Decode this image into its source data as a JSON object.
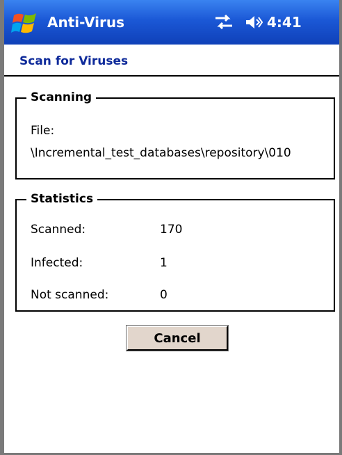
{
  "titlebar": {
    "app_title": "Anti-Virus",
    "time": "4:41",
    "icons": [
      "windows-flag-icon",
      "connectivity-icon",
      "volume-icon"
    ]
  },
  "page": {
    "heading": "Scan for Viruses"
  },
  "scanning": {
    "legend": "Scanning",
    "file_label": "File:",
    "file_path": "\\Incremental_test_databases\\repository\\010"
  },
  "statistics": {
    "legend": "Statistics",
    "rows": [
      {
        "label": "Scanned:",
        "value": "170"
      },
      {
        "label": "Infected:",
        "value": "1"
      },
      {
        "label": "Not scanned:",
        "value": "0"
      }
    ]
  },
  "actions": {
    "cancel_label": "Cancel"
  },
  "colors": {
    "titlebar_blue": "#1b58d6",
    "heading_blue": "#0e2a9a",
    "button_face": "#e2d6cc"
  }
}
